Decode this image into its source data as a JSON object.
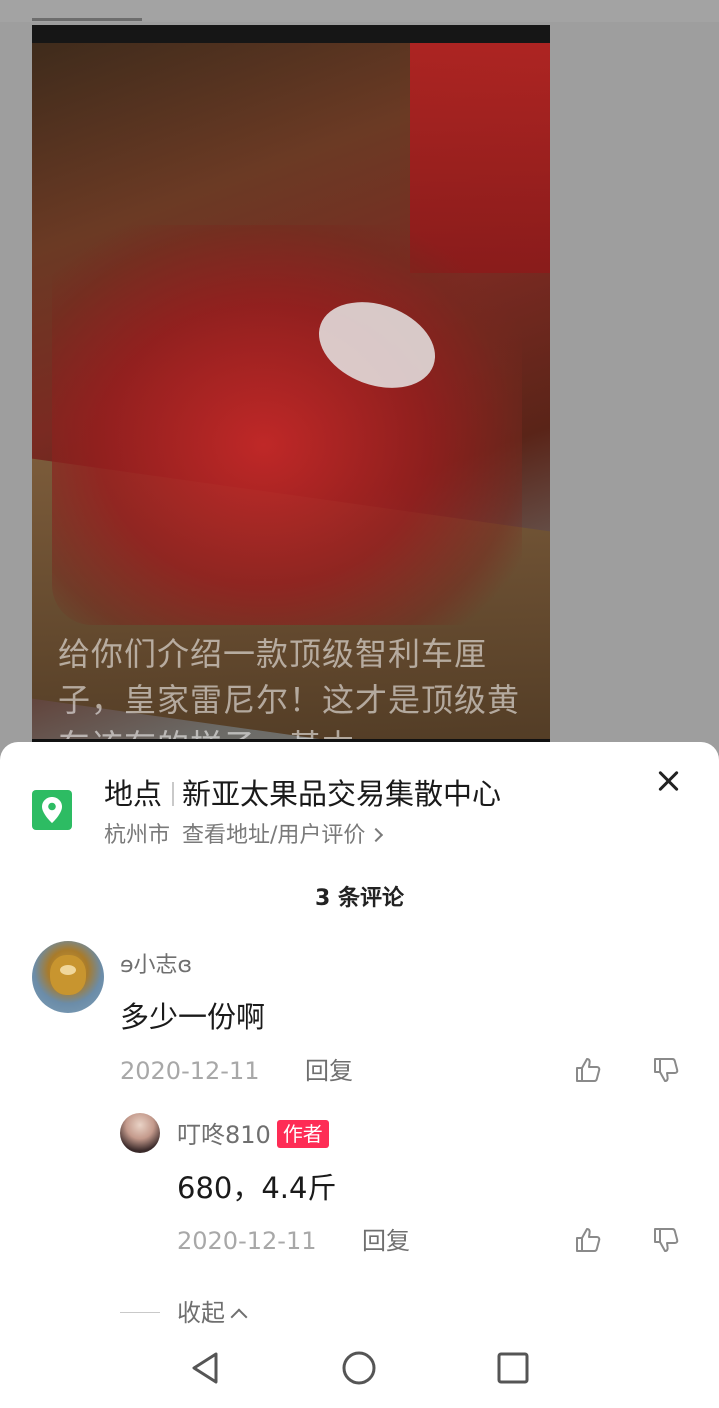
{
  "video": {
    "caption": "给你们介绍一款顶级智利车厘子，皇家雷尼尔！这才是顶级黄车该有的样子，基本"
  },
  "location": {
    "label": "地点",
    "name": "新亚太果品交易集散中心",
    "city": "杭州市",
    "link_text": "查看地址/用户评价",
    "icon": "map-pin-icon",
    "icon_color": "#2dbc63"
  },
  "comments_header": {
    "count_text": "3 条评论"
  },
  "comments": [
    {
      "username": "ɘ小志ɞ",
      "text": "多少一份啊",
      "date": "2020-12-11",
      "reply_label": "回复"
    }
  ],
  "reply": {
    "username": "叮咚810",
    "badge": "作者",
    "badge_color": "#fe2c55",
    "text": "680，4.4斤",
    "date": "2020-12-11",
    "reply_label": "回复"
  },
  "collapse_label": "收起",
  "navbar": {
    "back": "back-triangle-icon",
    "home": "home-circle-icon",
    "recents": "recents-square-icon"
  }
}
